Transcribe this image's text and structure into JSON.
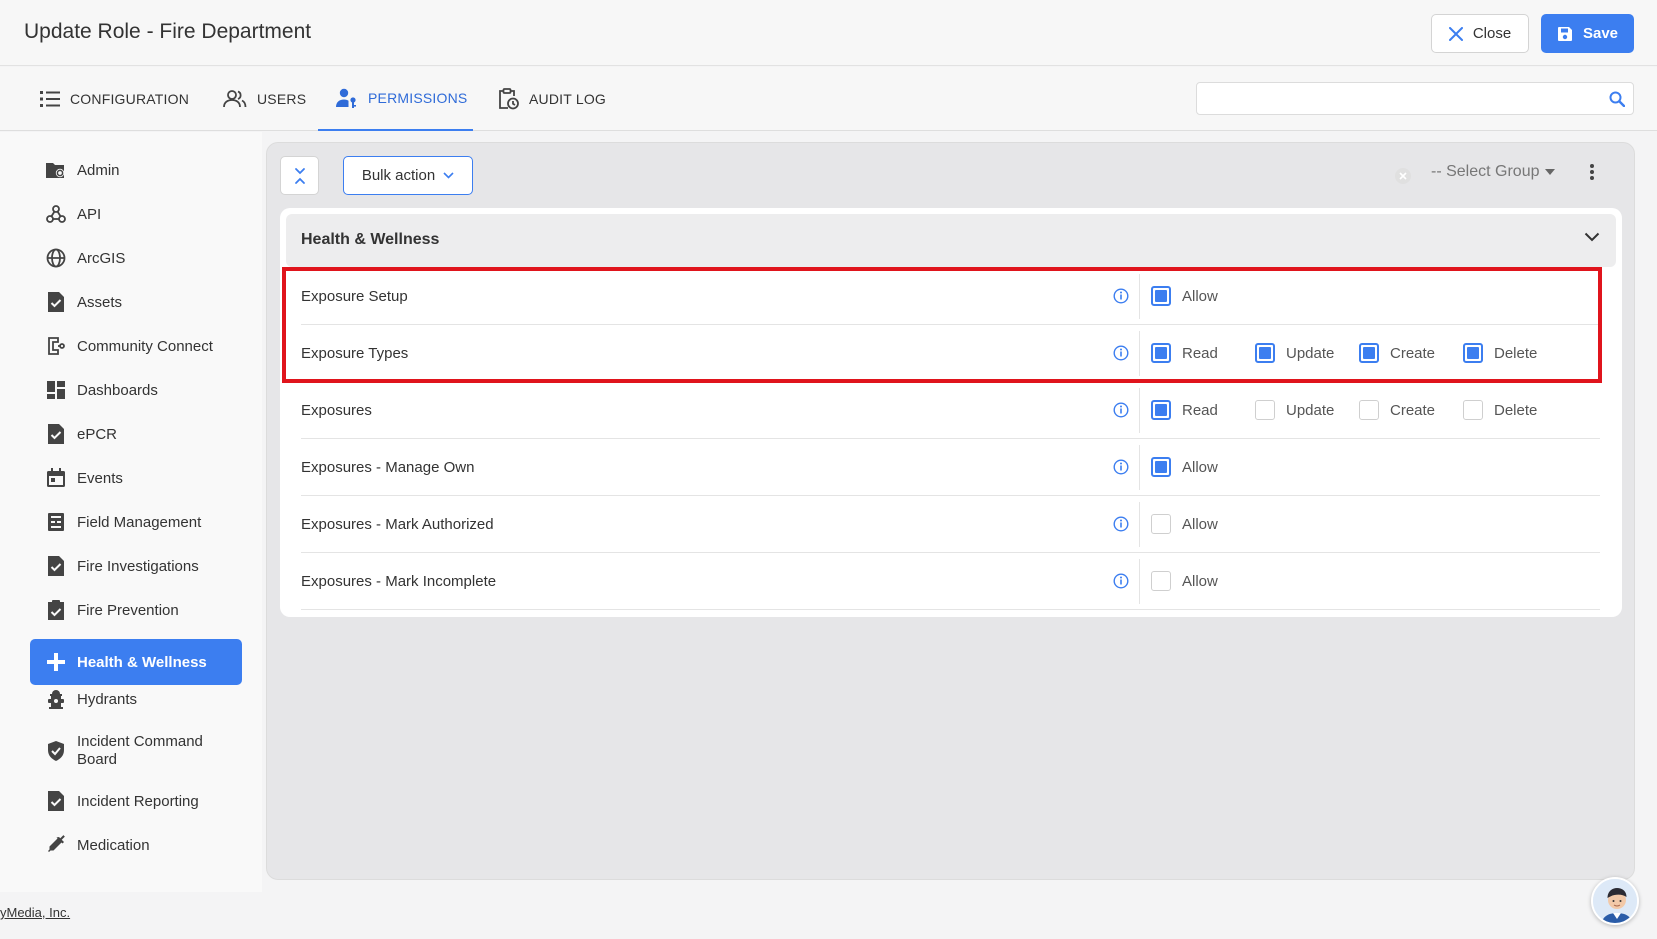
{
  "header": {
    "title": "Update Role - Fire Department",
    "close_label": "Close",
    "save_label": "Save"
  },
  "tabs": [
    {
      "label": "CONFIGURATION",
      "icon": "list-icon"
    },
    {
      "label": "USERS",
      "icon": "users-icon"
    },
    {
      "label": "PERMISSIONS",
      "icon": "user-key-icon",
      "active": true
    },
    {
      "label": "AUDIT LOG",
      "icon": "clipboard-clock-icon"
    }
  ],
  "search": {
    "value": "",
    "placeholder": ""
  },
  "sidebar": {
    "items": [
      {
        "label": "Admin",
        "icon": "folder-gear-icon"
      },
      {
        "label": "API",
        "icon": "webhook-icon"
      },
      {
        "label": "ArcGIS",
        "icon": "globe-icon"
      },
      {
        "label": "Assets",
        "icon": "doc-check-icon"
      },
      {
        "label": "Community Connect",
        "icon": "connect-icon"
      },
      {
        "label": "Dashboards",
        "icon": "dashboard-icon"
      },
      {
        "label": "ePCR",
        "icon": "doc-check-icon"
      },
      {
        "label": "Events",
        "icon": "calendar-icon"
      },
      {
        "label": "Field Management",
        "icon": "form-icon"
      },
      {
        "label": "Fire Investigations",
        "icon": "doc-check-icon"
      },
      {
        "label": "Fire Prevention",
        "icon": "clipboard-check-icon"
      },
      {
        "label": "Health & Wellness",
        "icon": "plus-icon",
        "active": true
      },
      {
        "label": "Hydrants",
        "icon": "hydrant-icon"
      },
      {
        "label": "Incident Command Board",
        "icon": "shield-check-icon"
      },
      {
        "label": "Incident Reporting",
        "icon": "doc-check-icon"
      },
      {
        "label": "Medication",
        "icon": "syringe-icon"
      }
    ]
  },
  "toolbar": {
    "bulk_label": "Bulk action",
    "group_placeholder": "-- Select Group"
  },
  "section": {
    "title": "Health & Wellness",
    "rows": [
      {
        "name": "Exposure Setup",
        "options": [
          {
            "label": "Allow",
            "checked": true
          }
        ]
      },
      {
        "name": "Exposure Types",
        "options": [
          {
            "label": "Read",
            "checked": true
          },
          {
            "label": "Update",
            "checked": true
          },
          {
            "label": "Create",
            "checked": true
          },
          {
            "label": "Delete",
            "checked": true
          }
        ]
      },
      {
        "name": "Exposures",
        "options": [
          {
            "label": "Read",
            "checked": true
          },
          {
            "label": "Update",
            "checked": false
          },
          {
            "label": "Create",
            "checked": false
          },
          {
            "label": "Delete",
            "checked": false
          }
        ]
      },
      {
        "name": "Exposures - Manage Own",
        "options": [
          {
            "label": "Allow",
            "checked": true
          }
        ]
      },
      {
        "name": "Exposures - Mark Authorized",
        "options": [
          {
            "label": "Allow",
            "checked": false
          }
        ]
      },
      {
        "name": "Exposures - Mark Incomplete",
        "options": [
          {
            "label": "Allow",
            "checked": false
          }
        ]
      }
    ]
  },
  "footer": {
    "text": "yMedia, Inc."
  },
  "colors": {
    "accent": "#3c7ef0",
    "highlight": "#e0141c"
  }
}
